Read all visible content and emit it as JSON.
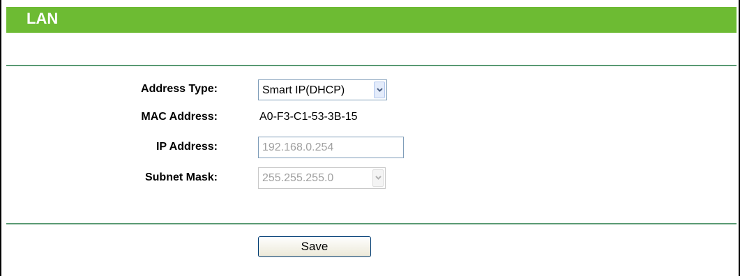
{
  "header": {
    "title": "LAN"
  },
  "form": {
    "address_type": {
      "label": "Address Type:",
      "selected": "Smart IP(DHCP)"
    },
    "mac_address": {
      "label": "MAC Address:",
      "value": "A0-F3-C1-53-3B-15"
    },
    "ip_address": {
      "label": "IP Address:",
      "value": "192.168.0.254"
    },
    "subnet_mask": {
      "label": "Subnet Mask:",
      "selected": "255.255.255.0"
    }
  },
  "actions": {
    "save_label": "Save"
  },
  "colors": {
    "header_bg": "#6dbb33",
    "divider": "#5a9a73",
    "disabled_text": "#a0a0a0"
  },
  "icons": {
    "dropdown": "chevron-down-icon"
  }
}
